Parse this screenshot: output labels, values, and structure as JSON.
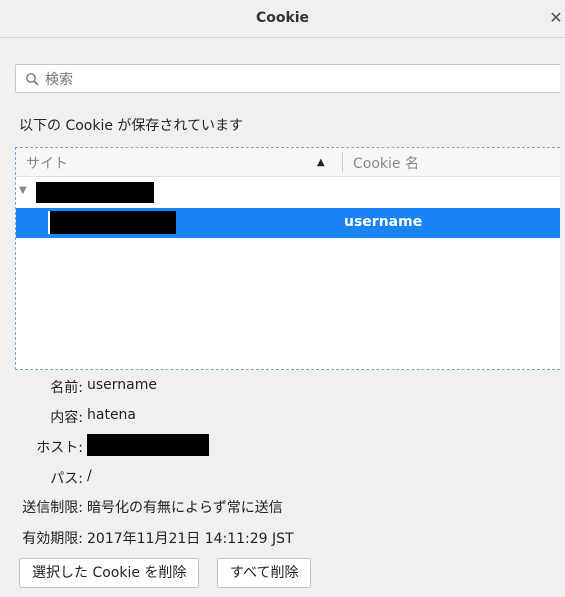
{
  "window": {
    "title": "Cookie",
    "close_glyph": "✕"
  },
  "search": {
    "placeholder": "検索",
    "value": ""
  },
  "description": "以下の Cookie が保存されています",
  "tree": {
    "columns": {
      "site": "サイト",
      "cookie_name": "Cookie 名",
      "sort_glyph": "▲"
    },
    "twisty_glyph": "▼",
    "rows": [
      {
        "level": 0,
        "site": "[redacted]",
        "cookie_name": "",
        "selected": false
      },
      {
        "level": 1,
        "site": "[redacted]",
        "cookie_name": "username",
        "selected": true
      }
    ]
  },
  "details": {
    "name": {
      "label": "名前:",
      "value": "username"
    },
    "content": {
      "label": "内容:",
      "value": "hatena"
    },
    "host": {
      "label": "ホスト:",
      "value": "[redacted]"
    },
    "path": {
      "label": "パス:",
      "value": "/"
    },
    "send_for": {
      "label": "送信制限:",
      "value": "暗号化の有無によらず常に送信"
    },
    "expires": {
      "label": "有効期限:",
      "value": "2017年11月21日 14:11:29 JST"
    }
  },
  "buttons": {
    "remove_selected": "選択した Cookie を削除",
    "remove_all": "すべて削除"
  }
}
